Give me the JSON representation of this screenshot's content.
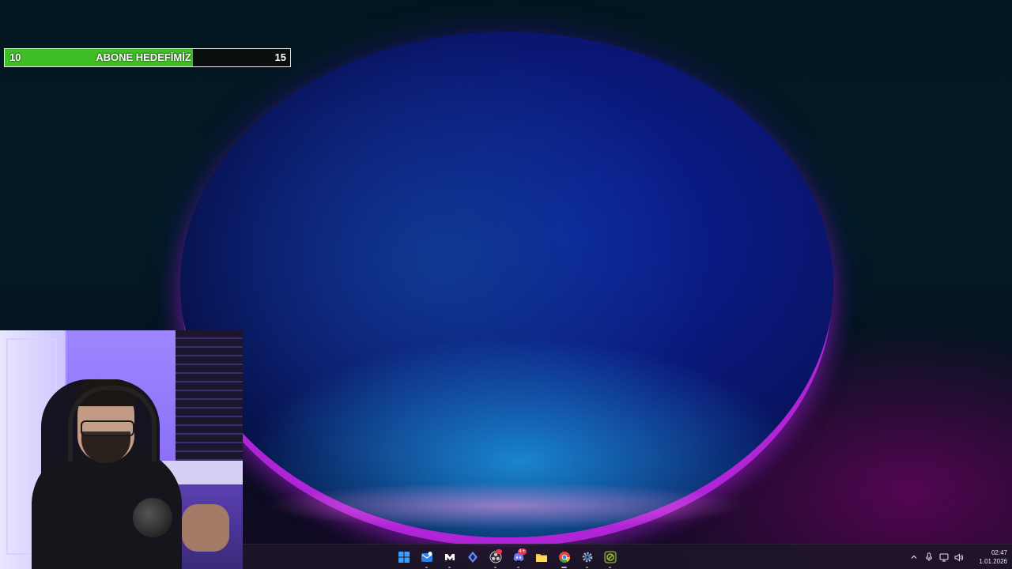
{
  "subscriber_goal": {
    "current": "10",
    "title": "ABONE HEDEFİMİZ",
    "target": "15",
    "progress_fraction": 0.66,
    "fill_color": "#3fbf25"
  },
  "taskbar": {
    "apps": [
      {
        "name": "start-button",
        "icon": "windows-logo-icon",
        "color": "#3aa0ff"
      },
      {
        "name": "mail-app",
        "icon": "mail-icon",
        "color": "#2f7fe6"
      },
      {
        "name": "game-launcher",
        "icon": "m-logo-icon",
        "color": "#ffffff"
      },
      {
        "name": "task-tool",
        "icon": "diamond-icon",
        "color": "#6a8dff"
      },
      {
        "name": "obs-studio",
        "icon": "obs-icon",
        "color": "#d0d0d0",
        "badge": ""
      },
      {
        "name": "discord",
        "icon": "discord-icon",
        "color": "#6c7ef2",
        "badge": "4+"
      },
      {
        "name": "file-explorer",
        "icon": "folder-icon",
        "color": "#f2c230"
      },
      {
        "name": "chrome",
        "icon": "chrome-icon",
        "color": "#e6453a",
        "active": true
      },
      {
        "name": "settings-app",
        "icon": "gear-icon",
        "color": "#9fb8d8"
      },
      {
        "name": "game-app",
        "icon": "game-icon",
        "color": "#a8c34a"
      }
    ],
    "tray": {
      "icons": [
        "chevron-up-icon",
        "microphone-icon",
        "network-icon",
        "volume-icon"
      ],
      "time": "02:47",
      "date": "1.01.2026"
    }
  }
}
